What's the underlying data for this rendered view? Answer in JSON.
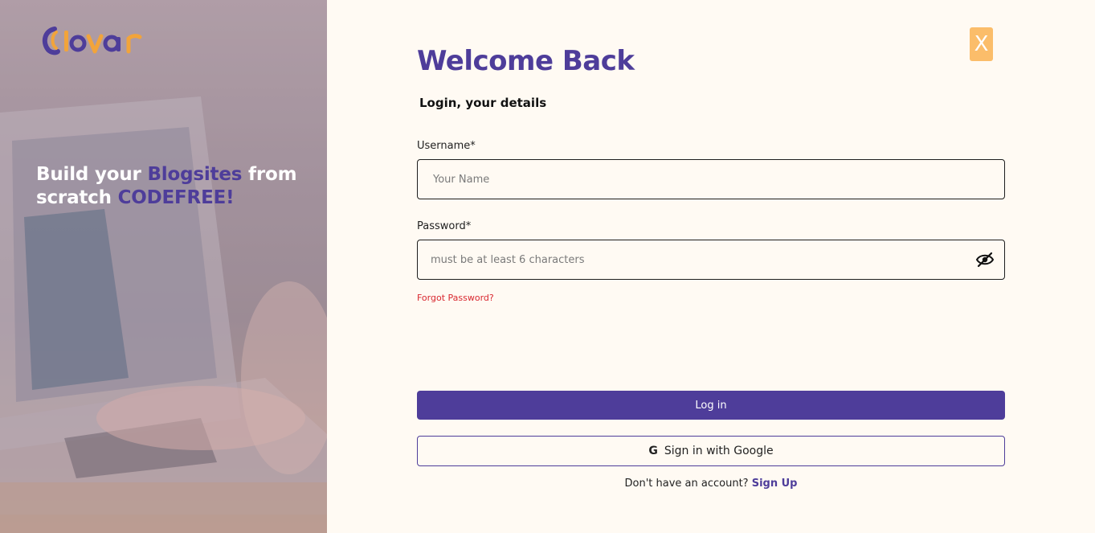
{
  "brand": {
    "logo_text": "clovar",
    "colors": {
      "purple": "#4e3d9a",
      "orange": "#f2a43a",
      "close": "#fbbd6a",
      "error": "#d9282f",
      "background": "#fffaf3"
    }
  },
  "hero": {
    "line1_pre": "Build your ",
    "line1_accent": "Blogsites",
    "line1_post": " from",
    "line2_pre": "scratch ",
    "line2_accent": "CODEFREE!"
  },
  "form": {
    "close_label": "X",
    "title": "Welcome Back",
    "subtitle": "Login, your details",
    "username": {
      "label": "Username*",
      "placeholder": "Your Name",
      "value": ""
    },
    "password": {
      "label": "Password*",
      "placeholder": "must be at least 6 characters",
      "value": "",
      "toggle_icon": "eye-slash-icon"
    },
    "forgot_label": "Forgot Password?",
    "login_label": "Log in",
    "google": {
      "icon": "google-g-icon",
      "glyph": "G",
      "label": "Sign in with Google"
    },
    "signup_prompt": "Don't have an account? ",
    "signup_link": "Sign Up"
  }
}
